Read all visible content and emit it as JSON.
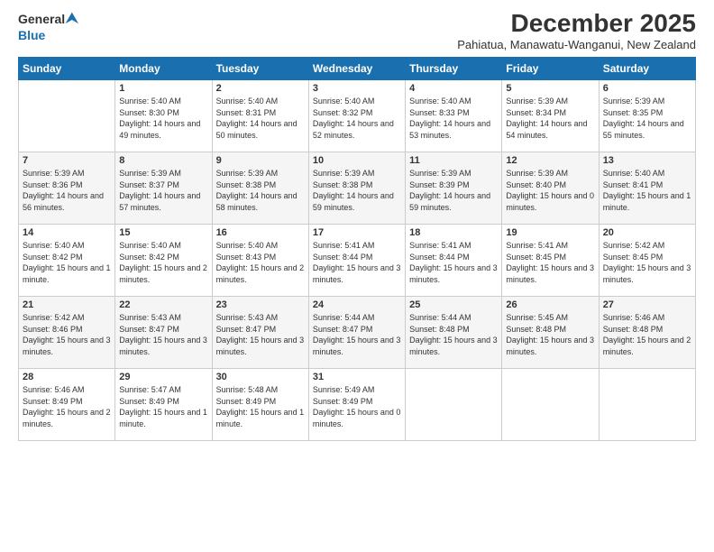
{
  "logo": {
    "general": "General",
    "blue": "Blue"
  },
  "title": "December 2025",
  "subtitle": "Pahiatua, Manawatu-Wanganui, New Zealand",
  "days_header": [
    "Sunday",
    "Monday",
    "Tuesday",
    "Wednesday",
    "Thursday",
    "Friday",
    "Saturday"
  ],
  "weeks": [
    [
      {
        "day": "",
        "sunrise": "",
        "sunset": "",
        "daylight": ""
      },
      {
        "day": "1",
        "sunrise": "Sunrise: 5:40 AM",
        "sunset": "Sunset: 8:30 PM",
        "daylight": "Daylight: 14 hours and 49 minutes."
      },
      {
        "day": "2",
        "sunrise": "Sunrise: 5:40 AM",
        "sunset": "Sunset: 8:31 PM",
        "daylight": "Daylight: 14 hours and 50 minutes."
      },
      {
        "day": "3",
        "sunrise": "Sunrise: 5:40 AM",
        "sunset": "Sunset: 8:32 PM",
        "daylight": "Daylight: 14 hours and 52 minutes."
      },
      {
        "day": "4",
        "sunrise": "Sunrise: 5:40 AM",
        "sunset": "Sunset: 8:33 PM",
        "daylight": "Daylight: 14 hours and 53 minutes."
      },
      {
        "day": "5",
        "sunrise": "Sunrise: 5:39 AM",
        "sunset": "Sunset: 8:34 PM",
        "daylight": "Daylight: 14 hours and 54 minutes."
      },
      {
        "day": "6",
        "sunrise": "Sunrise: 5:39 AM",
        "sunset": "Sunset: 8:35 PM",
        "daylight": "Daylight: 14 hours and 55 minutes."
      }
    ],
    [
      {
        "day": "7",
        "sunrise": "Sunrise: 5:39 AM",
        "sunset": "Sunset: 8:36 PM",
        "daylight": "Daylight: 14 hours and 56 minutes."
      },
      {
        "day": "8",
        "sunrise": "Sunrise: 5:39 AM",
        "sunset": "Sunset: 8:37 PM",
        "daylight": "Daylight: 14 hours and 57 minutes."
      },
      {
        "day": "9",
        "sunrise": "Sunrise: 5:39 AM",
        "sunset": "Sunset: 8:38 PM",
        "daylight": "Daylight: 14 hours and 58 minutes."
      },
      {
        "day": "10",
        "sunrise": "Sunrise: 5:39 AM",
        "sunset": "Sunset: 8:38 PM",
        "daylight": "Daylight: 14 hours and 59 minutes."
      },
      {
        "day": "11",
        "sunrise": "Sunrise: 5:39 AM",
        "sunset": "Sunset: 8:39 PM",
        "daylight": "Daylight: 14 hours and 59 minutes."
      },
      {
        "day": "12",
        "sunrise": "Sunrise: 5:39 AM",
        "sunset": "Sunset: 8:40 PM",
        "daylight": "Daylight: 15 hours and 0 minutes."
      },
      {
        "day": "13",
        "sunrise": "Sunrise: 5:40 AM",
        "sunset": "Sunset: 8:41 PM",
        "daylight": "Daylight: 15 hours and 1 minute."
      }
    ],
    [
      {
        "day": "14",
        "sunrise": "Sunrise: 5:40 AM",
        "sunset": "Sunset: 8:42 PM",
        "daylight": "Daylight: 15 hours and 1 minute."
      },
      {
        "day": "15",
        "sunrise": "Sunrise: 5:40 AM",
        "sunset": "Sunset: 8:42 PM",
        "daylight": "Daylight: 15 hours and 2 minutes."
      },
      {
        "day": "16",
        "sunrise": "Sunrise: 5:40 AM",
        "sunset": "Sunset: 8:43 PM",
        "daylight": "Daylight: 15 hours and 2 minutes."
      },
      {
        "day": "17",
        "sunrise": "Sunrise: 5:41 AM",
        "sunset": "Sunset: 8:44 PM",
        "daylight": "Daylight: 15 hours and 3 minutes."
      },
      {
        "day": "18",
        "sunrise": "Sunrise: 5:41 AM",
        "sunset": "Sunset: 8:44 PM",
        "daylight": "Daylight: 15 hours and 3 minutes."
      },
      {
        "day": "19",
        "sunrise": "Sunrise: 5:41 AM",
        "sunset": "Sunset: 8:45 PM",
        "daylight": "Daylight: 15 hours and 3 minutes."
      },
      {
        "day": "20",
        "sunrise": "Sunrise: 5:42 AM",
        "sunset": "Sunset: 8:45 PM",
        "daylight": "Daylight: 15 hours and 3 minutes."
      }
    ],
    [
      {
        "day": "21",
        "sunrise": "Sunrise: 5:42 AM",
        "sunset": "Sunset: 8:46 PM",
        "daylight": "Daylight: 15 hours and 3 minutes."
      },
      {
        "day": "22",
        "sunrise": "Sunrise: 5:43 AM",
        "sunset": "Sunset: 8:47 PM",
        "daylight": "Daylight: 15 hours and 3 minutes."
      },
      {
        "day": "23",
        "sunrise": "Sunrise: 5:43 AM",
        "sunset": "Sunset: 8:47 PM",
        "daylight": "Daylight: 15 hours and 3 minutes."
      },
      {
        "day": "24",
        "sunrise": "Sunrise: 5:44 AM",
        "sunset": "Sunset: 8:47 PM",
        "daylight": "Daylight: 15 hours and 3 minutes."
      },
      {
        "day": "25",
        "sunrise": "Sunrise: 5:44 AM",
        "sunset": "Sunset: 8:48 PM",
        "daylight": "Daylight: 15 hours and 3 minutes."
      },
      {
        "day": "26",
        "sunrise": "Sunrise: 5:45 AM",
        "sunset": "Sunset: 8:48 PM",
        "daylight": "Daylight: 15 hours and 3 minutes."
      },
      {
        "day": "27",
        "sunrise": "Sunrise: 5:46 AM",
        "sunset": "Sunset: 8:48 PM",
        "daylight": "Daylight: 15 hours and 2 minutes."
      }
    ],
    [
      {
        "day": "28",
        "sunrise": "Sunrise: 5:46 AM",
        "sunset": "Sunset: 8:49 PM",
        "daylight": "Daylight: 15 hours and 2 minutes."
      },
      {
        "day": "29",
        "sunrise": "Sunrise: 5:47 AM",
        "sunset": "Sunset: 8:49 PM",
        "daylight": "Daylight: 15 hours and 1 minute."
      },
      {
        "day": "30",
        "sunrise": "Sunrise: 5:48 AM",
        "sunset": "Sunset: 8:49 PM",
        "daylight": "Daylight: 15 hours and 1 minute."
      },
      {
        "day": "31",
        "sunrise": "Sunrise: 5:49 AM",
        "sunset": "Sunset: 8:49 PM",
        "daylight": "Daylight: 15 hours and 0 minutes."
      },
      {
        "day": "",
        "sunrise": "",
        "sunset": "",
        "daylight": ""
      },
      {
        "day": "",
        "sunrise": "",
        "sunset": "",
        "daylight": ""
      },
      {
        "day": "",
        "sunrise": "",
        "sunset": "",
        "daylight": ""
      }
    ]
  ]
}
